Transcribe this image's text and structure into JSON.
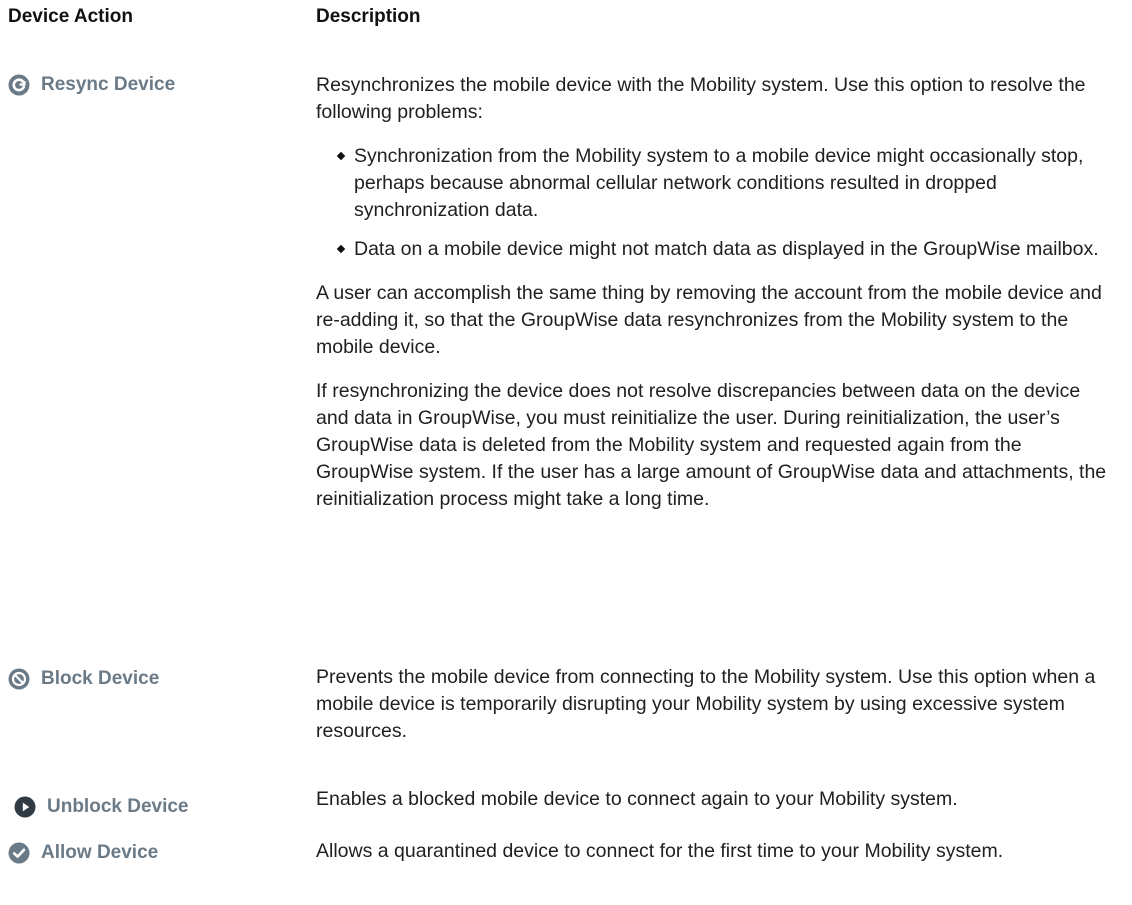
{
  "header": {
    "action": "Device Action",
    "description": "Description"
  },
  "rows": [
    {
      "action": "Resync Device",
      "icon": "resync-icon",
      "p1": "Resynchronizes the mobile device with the Mobility system. Use this option to resolve the following problems:",
      "bullets": [
        "Synchronization from the Mobility system to a mobile device might occasionally stop, perhaps because abnormal cellular network conditions resulted in dropped synchronization data.",
        "Data on a mobile device might not match data as displayed in the GroupWise mailbox."
      ],
      "p2": "A user can accomplish the same thing by removing the account from the mobile device and re-adding it, so that the GroupWise data resynchronizes from the Mobility system to the mobile device.",
      "p3": "If resynchronizing the device does not resolve discrepancies between data on the device and data in GroupWise, you must reinitialize the user. During reinitialization, the user’s GroupWise data is deleted from the Mobility system and requested again from the GroupWise system. If the user has a large amount of GroupWise data and attachments, the reinitialization process might take a long time."
    },
    {
      "action": "Block Device",
      "icon": "block-icon",
      "p1": "Prevents the mobile device from connecting to the Mobility system. Use this option when a mobile device is temporarily disrupting your Mobility system by using excessive system resources."
    },
    {
      "action": "Unblock Device",
      "icon": "play-icon",
      "p1": "Enables a blocked mobile device to connect again to your Mobility system."
    },
    {
      "action": "Allow Device",
      "icon": "checkmark-icon",
      "p1": "Allows a quarantined device to connect for the first time to your Mobility system."
    }
  ],
  "colors": {
    "icon": "#6b7a87",
    "action_text": "#6b7a87"
  }
}
